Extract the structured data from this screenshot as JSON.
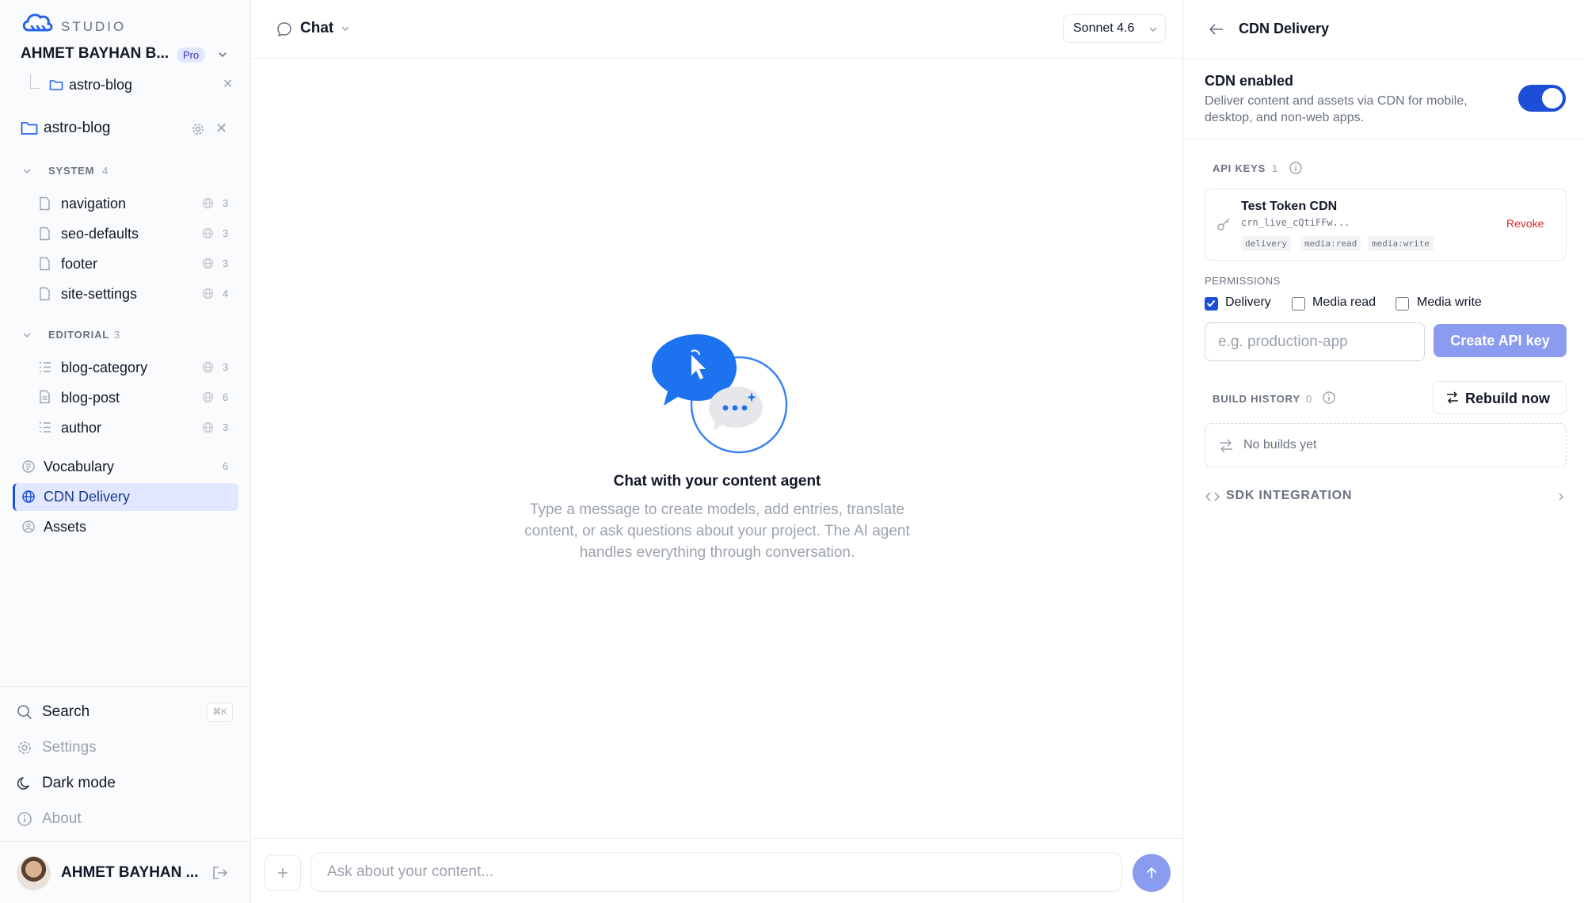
{
  "brand": {
    "name": "STUDIO"
  },
  "account": {
    "name": "AHMET BAYHAN B...",
    "plan": "Pro"
  },
  "sidebar": {
    "open_project": {
      "label": "astro-blog"
    },
    "project": {
      "label": "astro-blog"
    },
    "system": {
      "label": "SYSTEM",
      "count": "4",
      "items": [
        {
          "label": "navigation",
          "count": "3"
        },
        {
          "label": "seo-defaults",
          "count": "3"
        },
        {
          "label": "footer",
          "count": "3"
        },
        {
          "label": "site-settings",
          "count": "4"
        }
      ]
    },
    "editorial": {
      "label": "EDITORIAL",
      "count": "3",
      "items": [
        {
          "label": "blog-category",
          "count": "3"
        },
        {
          "label": "blog-post",
          "count": "6"
        },
        {
          "label": "author",
          "count": "3"
        }
      ]
    },
    "nav": [
      {
        "label": "Vocabulary",
        "count": "6"
      },
      {
        "label": "CDN Delivery"
      },
      {
        "label": "Assets"
      }
    ],
    "bottom": {
      "search": "Search",
      "search_shortcut": "⌘K",
      "settings": "Settings",
      "dark_mode": "Dark mode",
      "about": "About"
    },
    "user": {
      "name": "AHMET BAYHAN ..."
    }
  },
  "main": {
    "title": "Chat",
    "model": "Sonnet 4.6",
    "empty": {
      "title": "Chat with your content agent",
      "description": "Type a message to create models, add entries, translate content, or ask questions about your project. The AI agent handles everything through conversation."
    },
    "composer": {
      "placeholder": "Ask about your content..."
    }
  },
  "panel": {
    "title": "CDN Delivery",
    "cdn": {
      "title": "CDN enabled",
      "description": "Deliver content and assets via CDN for mobile, desktop, and non-web apps.",
      "enabled": true
    },
    "api_keys": {
      "label": "API KEYS",
      "count": "1",
      "keys": [
        {
          "name": "Test Token CDN",
          "value": "crn_live_cQtiFFw...",
          "scopes": [
            "delivery",
            "media:read",
            "media:write"
          ],
          "action": "Revoke"
        }
      ]
    },
    "permissions": {
      "label": "PERMISSIONS",
      "options": [
        {
          "label": "Delivery",
          "checked": true
        },
        {
          "label": "Media read",
          "checked": false
        },
        {
          "label": "Media write",
          "checked": false
        }
      ],
      "name_placeholder": "e.g. production-app",
      "create_label": "Create API key"
    },
    "build_history": {
      "label": "BUILD HISTORY",
      "count": "0",
      "rebuild_label": "Rebuild now",
      "empty": "No builds yet"
    },
    "sdk": {
      "label": "SDK INTEGRATION"
    }
  },
  "colors": {
    "accent": "#1d4ed8",
    "accent_soft": "#8b9cf0",
    "danger": "#dc2626",
    "selected_bg": "#e0e7ff"
  }
}
